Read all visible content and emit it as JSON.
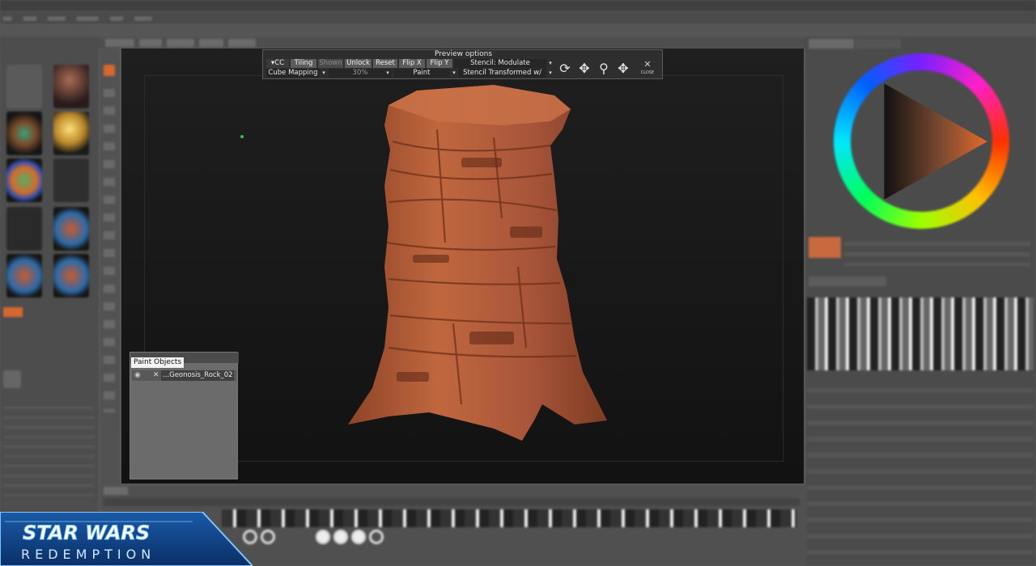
{
  "preview_options": {
    "title": "Preview  options",
    "row1": {
      "cc": "CC",
      "tiling": "Tiling",
      "shown": "Shown",
      "unlock": "Unlock",
      "reset": "Reset",
      "flip_x": "Flip  X",
      "flip_y": "Flip  Y",
      "stencil_mode": "Stencil:  Modulate"
    },
    "row2": {
      "mapping": "Cube  Mapping",
      "percent": "30%",
      "paint": "Paint",
      "stencil_transform": "Stencil  Transformed  w/"
    },
    "icons": [
      "rotate-icon",
      "move-icon",
      "zoom-icon",
      "pan-icon"
    ],
    "close_label": "CLOSE"
  },
  "paint_objects": {
    "title": "Paint  Objects",
    "objects": [
      {
        "name": "...Geonosis_Rock_02",
        "visible": true
      }
    ]
  },
  "logo": {
    "line1": "STAR WARS",
    "line2": "REDEMPTION"
  },
  "colors": {
    "current_color": "#c76a3f",
    "rock": "#b8603a",
    "viewport_bg": "#181818"
  }
}
